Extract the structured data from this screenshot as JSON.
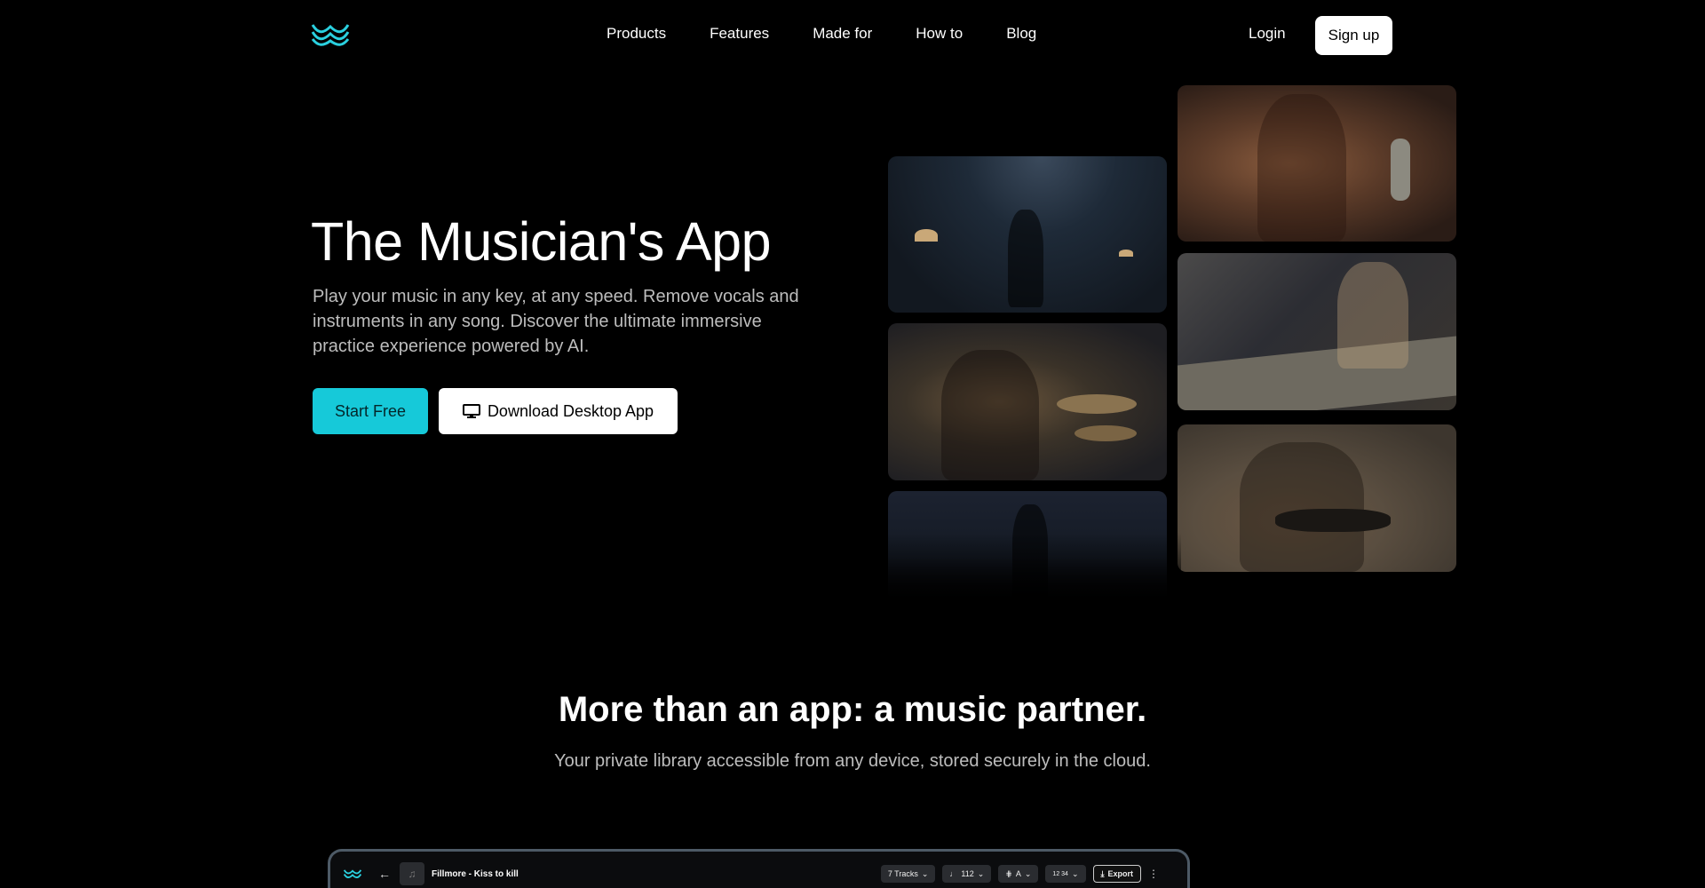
{
  "nav": {
    "links": [
      "Products",
      "Features",
      "Made for",
      "How to",
      "Blog"
    ],
    "login": "Login",
    "signup": "Sign up"
  },
  "hero": {
    "title": "The Musician's App",
    "subtitle": "Play your music in any key, at any speed. Remove vocals and instruments in any song. Discover the ultimate immersive practice experience powered by AI.",
    "start_label": "Start Free",
    "download_label": "Download Desktop App"
  },
  "section": {
    "title": "More than an app: a music partner.",
    "subtitle": "Your private library accessible from any device, stored securely in the cloud."
  },
  "app_preview": {
    "song": "Fillmore - Kiss to kill",
    "tracks": "7 Tracks",
    "tempo": "112",
    "key": "A",
    "meter": "12 34",
    "export": "Export"
  },
  "colors": {
    "accent": "#16c9d9",
    "background": "#000000"
  },
  "icons": {
    "logo": "wave-logo-icon",
    "download": "monitor-icon"
  }
}
